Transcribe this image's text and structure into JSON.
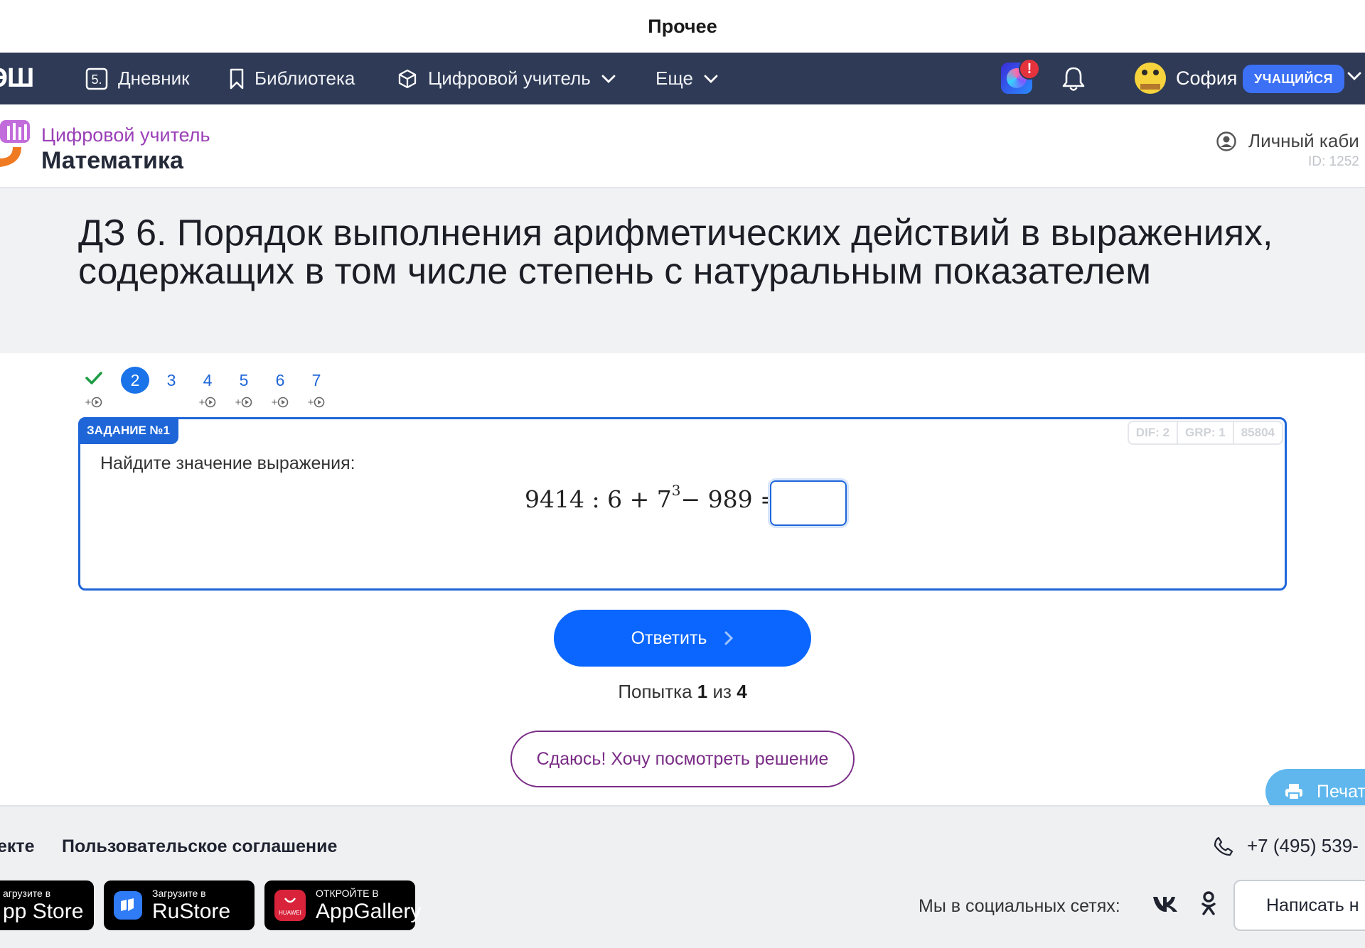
{
  "window": {
    "title": "Прочее"
  },
  "nav": {
    "brand": "ЭШ",
    "items": [
      {
        "label": "Дневник"
      },
      {
        "label": "Библиотека"
      },
      {
        "label": "Цифровой учитель"
      },
      {
        "label": "Еще"
      }
    ],
    "notification_badge": "!",
    "user_name": "София",
    "user_role": "УЧАЩИЙСЯ"
  },
  "subheader": {
    "product": "Цифровой учитель",
    "subject": "Математика",
    "cabinet_label": "Личный каби",
    "user_id": "ID: 1252"
  },
  "page": {
    "title": "ДЗ 6. Порядок выполнения арифметических действий в выражениях, содержащих в том числе степень с натуральным показателем"
  },
  "steps": [
    {
      "label": "✔",
      "done": true,
      "reward": "+"
    },
    {
      "label": "2",
      "current": true,
      "reward": ""
    },
    {
      "label": "3",
      "reward": ""
    },
    {
      "label": "4",
      "reward": "+"
    },
    {
      "label": "5",
      "reward": "+"
    },
    {
      "label": "6",
      "reward": "+"
    },
    {
      "label": "7",
      "reward": "+"
    }
  ],
  "task": {
    "label": "ЗАДАНИЕ №1",
    "meta": [
      "DIF: 2",
      "GRP: 1",
      "85804"
    ],
    "question": "Найдите значение выражения:",
    "expr_a": "9414 : 6 + 7",
    "expr_exp": "3",
    "expr_b": " − 989 =",
    "answer_value": ""
  },
  "actions": {
    "submit": "Ответить",
    "attempt_prefix": "Попытка",
    "attempt_current": "1",
    "attempt_mid": "из",
    "attempt_total": "4",
    "give_up": "Сдаюсь! Хочу посмотреть решение",
    "print": "Печат"
  },
  "footer": {
    "link_partial": "екте",
    "agreement": "Пользовательское соглашение",
    "phone": "+7 (495) 539-",
    "stores": [
      {
        "small": "агрузите в",
        "big": "pp Store"
      },
      {
        "small": "Загрузите в",
        "big": "RuStore"
      },
      {
        "small": "ОТКРОЙТЕ В",
        "big": "AppGallery",
        "brand": "HUAWEI"
      }
    ],
    "social_label": "Мы в социальных сетях:",
    "write_button": "Написать н"
  },
  "colors": {
    "nav_bg": "#2e3a56",
    "accent": "#1e66d8",
    "primary_button": "#0a66ff",
    "give_up": "#7a2d86",
    "product": "#9a3fb7",
    "role_badge": "#3c71f5"
  }
}
